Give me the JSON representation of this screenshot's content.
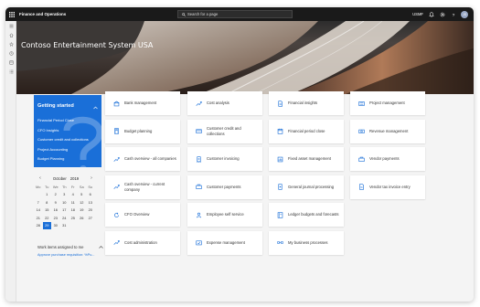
{
  "topbar": {
    "app_title": "Finance and Operations",
    "search_placeholder": "Search for a page",
    "company": "USMF",
    "avatar_initials": "JS"
  },
  "hero": {
    "title": "Contoso Entertainment System USA"
  },
  "getting_started": {
    "title": "Getting started",
    "links": [
      "Financial Period Close",
      "CFO Insights",
      "Customer credit and collections",
      "Project Accounting",
      "Budget Planning"
    ]
  },
  "calendar": {
    "month": "October",
    "year": "2019",
    "weekdays": [
      "Mo",
      "Tu",
      "We",
      "Th",
      "Fr",
      "Sa",
      "Su"
    ],
    "weeks": [
      [
        "",
        "1",
        "2",
        "3",
        "4",
        "5",
        "6"
      ],
      [
        "7",
        "8",
        "9",
        "10",
        "11",
        "12",
        "13"
      ],
      [
        "14",
        "15",
        "16",
        "17",
        "18",
        "19",
        "20"
      ],
      [
        "21",
        "22",
        "23",
        "24",
        "25",
        "26",
        "27"
      ],
      [
        "28",
        "29",
        "30",
        "31",
        "",
        "",
        ""
      ]
    ],
    "today": "29"
  },
  "work_items": {
    "title": "Work items assigned to me",
    "items": [
      "Approve purchase requisition: %Pu..."
    ]
  },
  "tiles": [
    {
      "label": "Bank management",
      "icon": "bank-icon"
    },
    {
      "label": "Cost analysis",
      "icon": "trend-icon"
    },
    {
      "label": "Financial insights",
      "icon": "document-icon"
    },
    {
      "label": "Project management",
      "icon": "list-icon"
    },
    {
      "label": "Budget planning",
      "icon": "calculator-icon"
    },
    {
      "label": "Customer credit and collections",
      "icon": "credit-card-icon"
    },
    {
      "label": "Financial period close",
      "icon": "calendar-icon"
    },
    {
      "label": "Revenue management",
      "icon": "revenue-icon"
    },
    {
      "label": "Cash overview - all companies",
      "icon": "trend-icon"
    },
    {
      "label": "Customer invoicing",
      "icon": "invoice-icon"
    },
    {
      "label": "Fixed asset management",
      "icon": "asset-icon"
    },
    {
      "label": "Vendor payments",
      "icon": "payment-icon"
    },
    {
      "label": "Cash overview - current company",
      "icon": "trend-icon"
    },
    {
      "label": "Customer payments",
      "icon": "payment-icon"
    },
    {
      "label": "General journal processing",
      "icon": "journal-icon"
    },
    {
      "label": "Vendor tax invoice entry",
      "icon": "tax-invoice-icon"
    },
    {
      "label": "CFO Overview",
      "icon": "refresh-icon"
    },
    {
      "label": "Employee self service",
      "icon": "person-icon"
    },
    {
      "label": "Ledger budgets and forecasts",
      "icon": "ledger-icon"
    },
    {
      "label": "Cost administration",
      "icon": "trend-icon"
    },
    {
      "label": "Expense management",
      "icon": "expense-icon"
    },
    {
      "label": "My business processes",
      "icon": "process-icon"
    }
  ],
  "colors": {
    "accent": "#1a6fd8",
    "topbar": "#1a1a1a"
  }
}
